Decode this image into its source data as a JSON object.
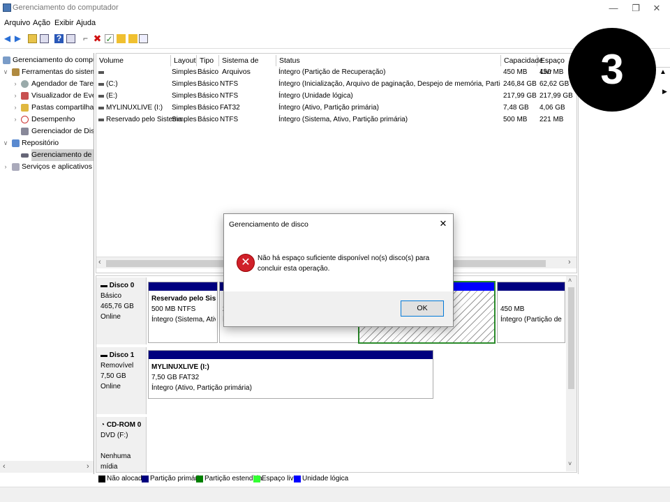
{
  "window": {
    "title": "Gerenciamento do computador"
  },
  "menu": [
    "Arquivo",
    "Ação",
    "Exibir",
    "Ajuda"
  ],
  "tree": [
    {
      "label": "Gerenciamento do computado",
      "level": 0,
      "icon": "computer-icon"
    },
    {
      "label": "Ferramentas do sistema",
      "level": 1,
      "icon": "tools-icon"
    },
    {
      "label": "Agendador de Tarefas",
      "level": 2,
      "icon": "clock-icon"
    },
    {
      "label": "Visualizador de Eventos",
      "level": 2,
      "icon": "event-viewer-icon"
    },
    {
      "label": "Pastas compartilhadas",
      "level": 2,
      "icon": "shared-folder-icon"
    },
    {
      "label": "Desempenho",
      "level": 2,
      "icon": "performance-icon"
    },
    {
      "label": "Gerenciador de Disposit",
      "level": 2,
      "icon": "device-manager-icon"
    },
    {
      "label": "Repositório",
      "level": 1,
      "icon": "storage-icon"
    },
    {
      "label": "Gerenciamento de disco",
      "level": 2,
      "icon": "disk-icon"
    },
    {
      "label": "Serviços e aplicativos",
      "level": 1,
      "icon": "services-icon"
    }
  ],
  "columns": [
    "Volume",
    "Layout",
    "Tipo",
    "Sistema de Arquivos",
    "Status",
    "Capacidade",
    "Espaço Livr"
  ],
  "volumes": [
    [
      "",
      "Simples",
      "Básico",
      "",
      "Íntegro (Partição de Recuperação)",
      "450 MB",
      "450 MB"
    ],
    [
      "(C:)",
      "Simples",
      "Básico",
      "NTFS",
      "Íntegro (Inicialização, Arquivo de paginação, Despejo de memória, Partição primária)",
      "246,84 GB",
      "62,62 GB"
    ],
    [
      "(E:)",
      "Simples",
      "Básico",
      "NTFS",
      "Íntegro (Unidade lógica)",
      "217,99 GB",
      "217,99 GB"
    ],
    [
      "MYLINUXLIVE (I:)",
      "Simples",
      "Básico",
      "FAT32",
      "Íntegro (Ativo, Partição primária)",
      "7,48 GB",
      "4,06 GB"
    ],
    [
      "Reservado pelo Sistema",
      "Simples",
      "Básico",
      "NTFS",
      "Íntegro (Sistema, Ativo, Partição primária)",
      "500 MB",
      "221 MB"
    ]
  ],
  "disks": {
    "disk0": {
      "name": "Disco 0",
      "type": "Básico",
      "size": "465,76 GB",
      "state": "Online",
      "p1": {
        "name": "Reservado pelo Sistem",
        "size": "500 MB NTFS",
        "status": "Íntegro (Sistema, Ativo,"
      },
      "p2": {
        "size": "24",
        "status": "Ín"
      },
      "p4": {
        "size": "450 MB",
        "status": "Íntegro (Partição de Rec"
      }
    },
    "disk1": {
      "name": "Disco 1",
      "type": "Removível",
      "size": "7,50 GB",
      "state": "Online",
      "p1": {
        "name": "MYLINUXLIVE  (I:)",
        "size": "7,50 GB FAT32",
        "status": "Íntegro (Ativo, Partição primária)"
      }
    },
    "cdrom": {
      "name": "CD-ROM 0",
      "type": "DVD (F:)",
      "state": "Nenhuma mídia"
    }
  },
  "legend": [
    {
      "label": "Não alocado",
      "color": "#000000"
    },
    {
      "label": "Partição primária",
      "color": "#00007f"
    },
    {
      "label": "Partição estendida",
      "color": "#008000"
    },
    {
      "label": "Espaço livre",
      "color": "#33ff33"
    },
    {
      "label": "Unidade lógica",
      "color": "#0000ff"
    }
  ],
  "dialog": {
    "title": "Gerenciamento de disco",
    "message": "Não há espaço suficiente disponível no(s) disco(s) para concluir esta operação.",
    "ok": "OK"
  },
  "badge": "3"
}
